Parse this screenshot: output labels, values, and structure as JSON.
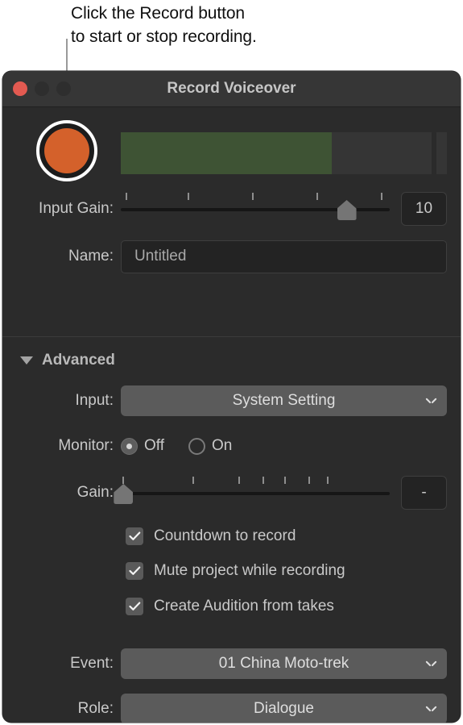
{
  "callout": {
    "text": "Click the Record button\nto start or stop recording."
  },
  "window": {
    "title": "Record Voiceover",
    "traffic_lights": {
      "close_color": "#e35a51",
      "minimize_color": "#2e2e2e",
      "zoom_color": "#2e2e2e"
    }
  },
  "record": {
    "button_name": "Record",
    "button_color": "#d4612b",
    "meter": {
      "level_percent": 68,
      "fill_color": "#3e5334",
      "track_color": "#353535"
    }
  },
  "input_gain": {
    "label": "Input Gain:",
    "value": "10",
    "thumb_percent": 84,
    "ticks_percent": [
      2,
      25,
      49,
      73,
      97
    ]
  },
  "name": {
    "label": "Name:",
    "value": "Untitled",
    "placeholder": "Untitled"
  },
  "advanced": {
    "label": "Advanced",
    "expanded": true,
    "input": {
      "label": "Input:",
      "value": "System Setting"
    },
    "monitor": {
      "label": "Monitor:",
      "options": [
        {
          "label": "Off",
          "selected": true
        },
        {
          "label": "On",
          "selected": false
        }
      ]
    },
    "gain": {
      "label": "Gain:",
      "value": "-",
      "thumb_percent": 1,
      "ticks_percent": [
        1,
        27,
        44,
        53,
        61,
        70,
        77
      ]
    },
    "checkboxes": [
      {
        "label": "Countdown to record",
        "checked": true
      },
      {
        "label": "Mute project while recording",
        "checked": true
      },
      {
        "label": "Create Audition from takes",
        "checked": true
      }
    ],
    "event": {
      "label": "Event:",
      "value": "01 China Moto-trek"
    },
    "role": {
      "label": "Role:",
      "value": "Dialogue"
    }
  },
  "icons": {
    "disclosure": "triangle-down-icon",
    "popup_chevron": "chevron-down-icon",
    "checkmark": "checkmark-icon"
  }
}
